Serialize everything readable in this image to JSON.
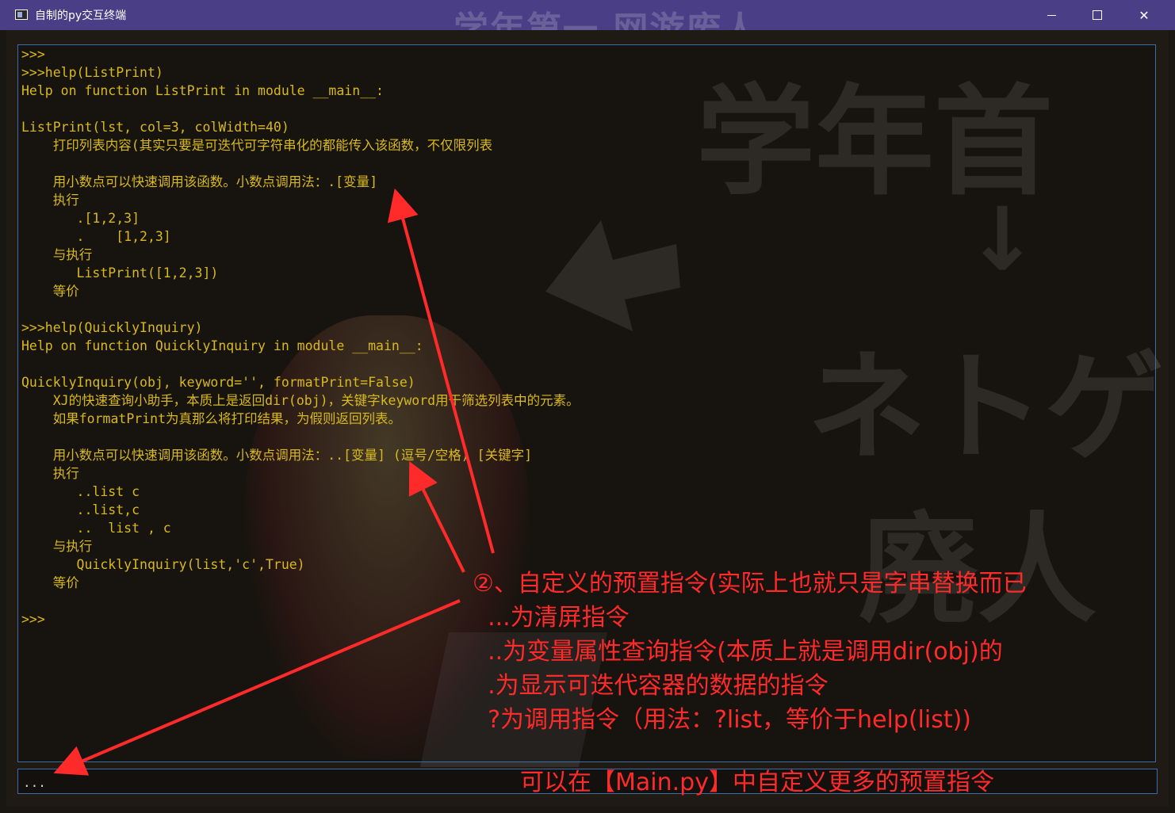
{
  "window": {
    "title": "自制的py交互终端",
    "watermark": "学年第一 网游废人",
    "controls": {
      "minimize": "—",
      "maximize": "□",
      "close": "✕"
    }
  },
  "background_art": {
    "text_lines": [
      "学年首",
      "↓",
      "ネトゲ",
      "廃人"
    ]
  },
  "output_lines": [
    ">>>",
    ">>>help(ListPrint)",
    "Help on function ListPrint in module __main__:",
    "",
    "ListPrint(lst, col=3, colWidth=40)",
    "    打印列表内容(其实只要是可迭代可字符串化的都能传入该函数，不仅限列表",
    "",
    "    用小数点可以快速调用该函数。小数点调用法：.[变量]",
    "    执行",
    "       .[1,2,3]",
    "       .    [1,2,3]",
    "    与执行",
    "       ListPrint([1,2,3])",
    "    等价",
    "",
    ">>>help(QuicklyInquiry)",
    "Help on function QuicklyInquiry in module __main__:",
    "",
    "QuicklyInquiry(obj, keyword='', formatPrint=False)",
    "    XJ的快速查询小助手，本质上是返回dir(obj)，关键字keyword用于筛选列表中的元素。",
    "    如果formatPrint为真那么将打印结果，为假则返回列表。",
    "",
    "    用小数点可以快速调用该函数。小数点调用法：..[变量] (逗号/空格) [关键字]",
    "    执行",
    "       ..list c",
    "       ..list,c",
    "       ..  list , c",
    "    与执行",
    "       QuicklyInquiry(list,'c',True)",
    "    等价",
    "",
    ">>>"
  ],
  "input": {
    "value": "..."
  },
  "annotations": {
    "block_lines": [
      "②、自定义的预置指令(实际上也就只是字串替换而已",
      "  ...为清屏指令",
      "  ..为变量属性查询指令(本质上就是调用dir(obj)的",
      "  .为显示可迭代容器的数据的指令",
      "  ?为调用指令（用法：?list，等价于help(list))"
    ],
    "footer": "可以在【Main.py】中自定义更多的预置指令"
  },
  "colors": {
    "titlebar": "#4a3f86",
    "terminal_text": "#d8b91e",
    "annotation": "#ff2a2a",
    "border": "#3a6ea8"
  }
}
